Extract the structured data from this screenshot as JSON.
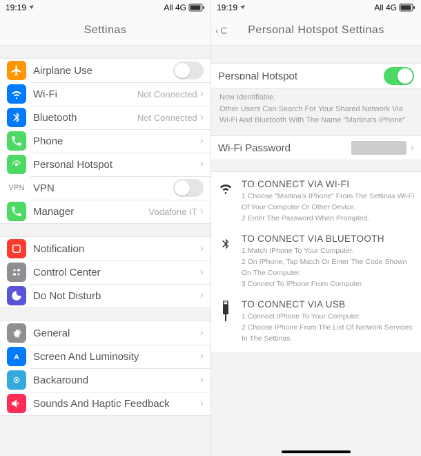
{
  "status": {
    "time": "19:19",
    "network": "All 4G"
  },
  "left": {
    "title": "Settinas",
    "rows": {
      "airplane": "Airplane Use",
      "wifi": "Wi-Fi",
      "wifi_val": "Not Connected",
      "bt": "Bluetooth",
      "bt_val": "Not Connected",
      "phone": "Phone",
      "hotspot": "Personal Hotspot",
      "vpn": "VPN",
      "vpn_icon": "VPN",
      "manager": "Manager",
      "manager_val": "Vodafone IT",
      "notif": "Notification",
      "cc": "Control Center",
      "dnd": "Do Not Disturb",
      "general": "General",
      "screen": "Screen And Luminosity",
      "bg": "Backaround",
      "sounds": "Sounds And Haptic Feedback"
    }
  },
  "right": {
    "back": "C",
    "title": "Personal Hotspot Settinas",
    "hotspot_label": "Persɒnal Hotspot",
    "help1": "Now Identifiable.",
    "help2": "Other Users Can Search For Your Shared Network Via Wi-Fi And Bluetooth With The Name \"Martina's IPhone\".",
    "pw_label": "Wi-Fi Password",
    "wifi": {
      "title": "TO CONNECT VIA WI-FI",
      "s1": "1 Choose \"Martina's IPhone\" From The Settinas Wi-Fi Of Your Computer Or Other Device.",
      "s2": "2 Enter The Password When Prompted."
    },
    "bt": {
      "title": "TO CONNECT VIA BLUETOOTH",
      "s1": "1 Match IPhone To Your Computer.",
      "s2": "2 On IPhone, Tap Match Or Enter The Code Shown On The Computer.",
      "s3": "3 Connect To IPhone From Computer."
    },
    "usb": {
      "title": "TO CONNECT VIA USB",
      "s1": "1 Connect IPhone To Your Computer.",
      "s2": "2 Choose IPhone From The List Of Network Services In The Settinas."
    }
  }
}
